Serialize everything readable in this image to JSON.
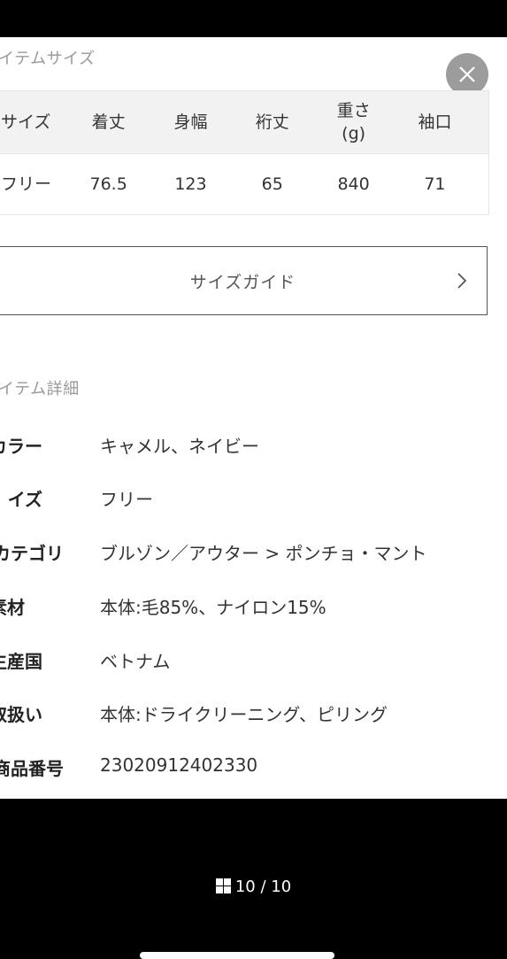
{
  "item_size": {
    "title": "イテムサイズ",
    "headers": [
      "サイズ",
      "着丈",
      "身幅",
      "裄丈",
      "重さ\n(g)",
      "袖口"
    ],
    "rows": [
      [
        "フリー",
        "76.5",
        "123",
        "65",
        "840",
        "71"
      ]
    ]
  },
  "size_guide": {
    "label": "サイズガイド"
  },
  "item_details": {
    "title": "イテム詳細",
    "rows": [
      {
        "key": "カラー",
        "value": "キャメル、ネイビー"
      },
      {
        "key": "イズ",
        "value": "フリー"
      },
      {
        "key": "カテゴリ",
        "value": "ブルゾン／アウター > ポンチョ・マント"
      },
      {
        "key": "素材",
        "value": "本体:毛85%、ナイロン15%"
      },
      {
        "key": "生産国",
        "value": "ベトナム"
      },
      {
        "key": "取扱い",
        "value": "本体:ドライクリーニング、ピリング"
      },
      {
        "key": "商品番号",
        "value": "23020912402330"
      }
    ]
  },
  "viewer": {
    "counter": "10 / 10",
    "close_icon": "close-icon",
    "grid_icon": "grid-icon"
  },
  "colors": {
    "close_button_bg": "#9c9c9c",
    "table_header_bg": "#f2f2f2",
    "section_title": "#999999"
  }
}
